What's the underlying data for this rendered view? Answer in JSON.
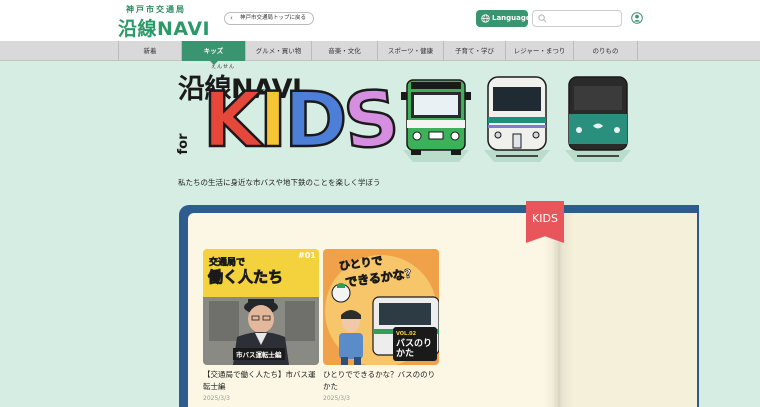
{
  "header": {
    "logo_sub": "神戸市交通局",
    "logo_main": "沿線NAVI",
    "back_link": "神戸市交通局トップに戻る",
    "language_label": "Language",
    "search": {
      "placeholder": ""
    }
  },
  "nav": {
    "items": [
      {
        "label": "新着"
      },
      {
        "label": "キッズ",
        "active": true
      },
      {
        "label": "グルメ・買い物"
      },
      {
        "label": "音楽・文化"
      },
      {
        "label": "スポーツ・健康"
      },
      {
        "label": "子育て・学び"
      },
      {
        "label": "レジャー・まつり"
      },
      {
        "label": "のりもの"
      }
    ]
  },
  "hero": {
    "ruby": "えんせん",
    "title": "沿線NAVI",
    "for_text": "for",
    "kids_letters": [
      "K",
      "I",
      "D",
      "S"
    ],
    "tagline": "私たちの生活に身近な市バスや地下鉄のことを楽しく学ぼう"
  },
  "book": {
    "ribbon_label": "KIDS"
  },
  "cards": [
    {
      "badge": "#01",
      "thumb_line1": "交通局で",
      "thumb_line2": "働く人たち",
      "thumb_caption": "市バス運転士編",
      "title": "【交通局で働く人たち】市バス運転士編",
      "date": "2025/3/3"
    },
    {
      "thumb_line1": "ひとりで",
      "thumb_line2": "できるかな?",
      "thumb_caption_vol": "VOL.02",
      "thumb_caption": "バスのりかた",
      "title": "ひとりでできるかな？バスののりかた",
      "date": "2025/3/3"
    }
  ],
  "colors": {
    "brand_green": "#3a9470",
    "background": "#d6ede4",
    "book_cover": "#2f5c8f",
    "ribbon": "#e8555a"
  }
}
